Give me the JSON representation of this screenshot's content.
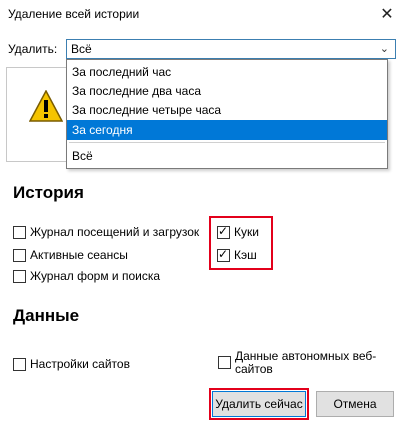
{
  "window": {
    "title": "Удаление всей истории",
    "close_glyph": "✕"
  },
  "delete_row": {
    "label": "Удалить:",
    "selected_value": "Всё",
    "arrow": "⌄"
  },
  "dropdown": {
    "options": [
      "За последний час",
      "За последние два часа",
      "За последние четыре часа",
      "За сегодня",
      "Всё"
    ],
    "highlighted_index": 3
  },
  "history": {
    "heading": "История",
    "items": [
      {
        "label": "Журнал посещений и загрузок",
        "checked": false
      },
      {
        "label": "Активные сеансы",
        "checked": false
      },
      {
        "label": "Журнал форм и поиска",
        "checked": false
      },
      {
        "label": "Куки",
        "checked": true
      },
      {
        "label": "Кэш",
        "checked": true
      }
    ]
  },
  "data_section": {
    "heading": "Данные",
    "items": [
      {
        "label": "Настройки сайтов",
        "checked": false
      },
      {
        "label": "Данные автономных веб-сайтов",
        "checked": false
      }
    ]
  },
  "buttons": {
    "clear_now": "Удалить сейчас",
    "cancel": "Отмена"
  },
  "colors": {
    "highlight": "#e3001b",
    "selection": "#0078d7"
  }
}
